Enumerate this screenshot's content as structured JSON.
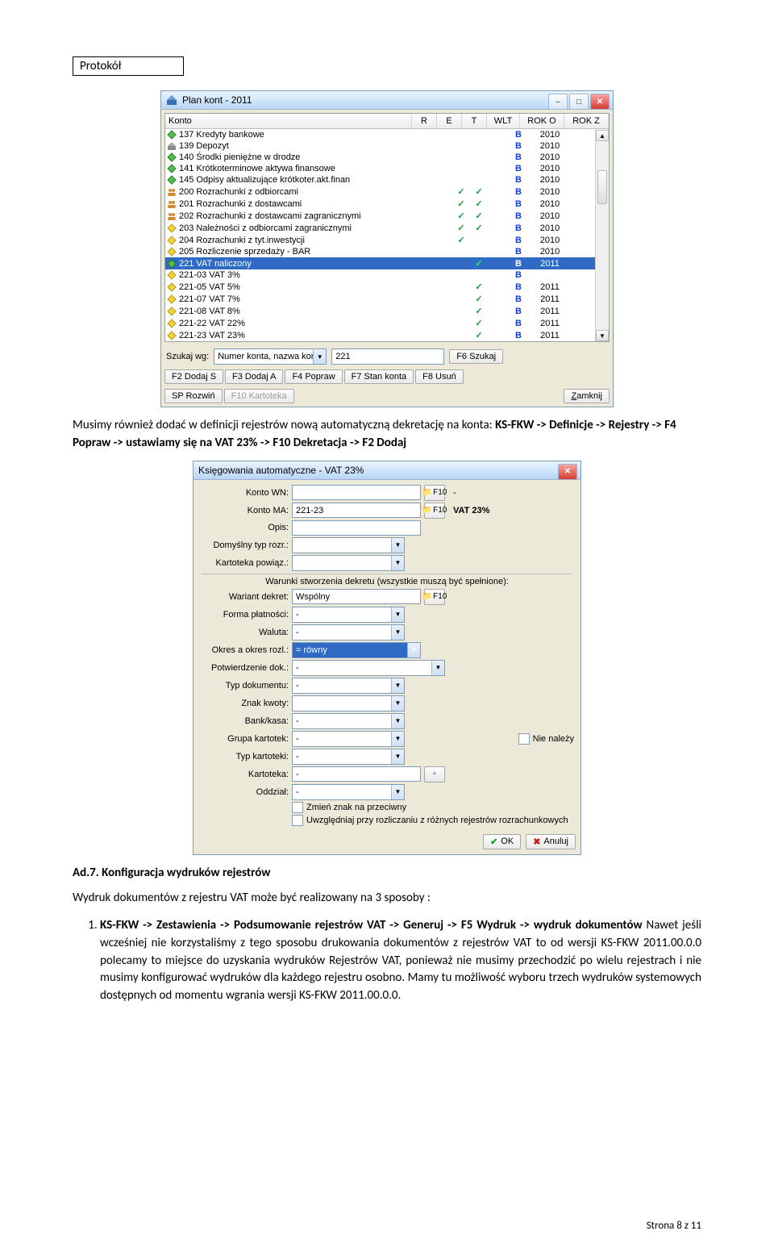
{
  "doc": {
    "header": "Protokół",
    "p1_a": "Musimy również dodać w definicji rejestrów nową automatyczną dekretację na konta: ",
    "p1_b": "KS-FKW -> Definicje -> Rejestry -> F4 Popraw -> ustawiamy się na VAT 23% -> F10 Dekretacja -> F2 Dodaj",
    "ad7": "Ad.7. Konfiguracja wydruków rejestrów",
    "p2": "Wydruk dokumentów z rejestru VAT może być realizowany na 3 sposoby :",
    "li1_b": "KS-FKW -> Zestawienia -> Podsumowanie rejestrów VAT -> Generuj -> F5 Wydruk -> wydruk dokumentów",
    "li1_rest": "Nawet jeśli wcześniej nie korzystaliśmy z tego sposobu drukowania dokumentów z rejestrów VAT to od wersji KS-FKW 2011.00.0.0 polecamy  to miejsce do uzyskania wydruków Rejestrów  VAT, ponieważ nie musimy przechodzić po wielu rejestrach i nie musimy konfigurować wydruków dla każdego rejestru osobno. Mamy tu możliwość wyboru trzech wydruków systemowych dostępnych od momentu wgrania wersji KS-FKW 2011.00.0.0.",
    "footer": "Strona 8 z 11"
  },
  "win1": {
    "title": "Plan kont - 2011",
    "headers": {
      "konto": "Konto",
      "r": "R",
      "e": "E",
      "t": "T",
      "wlt": "WLT",
      "roko": "ROK O",
      "rokz": "ROK Z"
    },
    "rows": [
      {
        "ico": "green",
        "label": "137 Kredyty bankowe",
        "r": "",
        "e": "",
        "t": "",
        "wlt": "B",
        "roko": "2010",
        "rokz": ""
      },
      {
        "ico": "bank",
        "label": "139 Depozyt",
        "r": "",
        "e": "",
        "t": "",
        "wlt": "B",
        "roko": "2010",
        "rokz": ""
      },
      {
        "ico": "green",
        "label": "140  Środki pieniężne w drodze",
        "r": "",
        "e": "",
        "t": "",
        "wlt": "B",
        "roko": "2010",
        "rokz": ""
      },
      {
        "ico": "green",
        "label": "141 Krótkoterminowe aktywa finansowe",
        "r": "",
        "e": "",
        "t": "",
        "wlt": "B",
        "roko": "2010",
        "rokz": ""
      },
      {
        "ico": "green",
        "label": "145 Odpisy aktualizujące krótkoter.akt.finan",
        "r": "",
        "e": "",
        "t": "",
        "wlt": "B",
        "roko": "2010",
        "rokz": ""
      },
      {
        "ico": "people",
        "label": "200 Rozrachunki z odbiorcami",
        "r": "✓",
        "e": "✓",
        "t": "",
        "wlt": "B",
        "roko": "2010",
        "rokz": ""
      },
      {
        "ico": "people",
        "label": "201 Rozrachunki z dostawcami",
        "r": "✓",
        "e": "✓",
        "t": "",
        "wlt": "B",
        "roko": "2010",
        "rokz": ""
      },
      {
        "ico": "people",
        "label": "202 Rozrachunki z dostawcami zagranicznymi",
        "r": "✓",
        "e": "✓",
        "t": "",
        "wlt": "B",
        "roko": "2010",
        "rokz": ""
      },
      {
        "ico": "yellow",
        "label": "203 Należności z odbiorcami zagranicznymi",
        "r": "✓",
        "e": "✓",
        "t": "",
        "wlt": "B",
        "roko": "2010",
        "rokz": ""
      },
      {
        "ico": "yellow",
        "label": "204  Rozrachunki z tyt.inwestycji",
        "r": "✓",
        "e": "",
        "t": "",
        "wlt": "B",
        "roko": "2010",
        "rokz": ""
      },
      {
        "ico": "yellow",
        "label": "205 Rozliczenie sprzedaży - BAR",
        "r": "",
        "e": "",
        "t": "",
        "wlt": "B",
        "roko": "2010",
        "rokz": ""
      },
      {
        "ico": "green",
        "label": "221 VAT naliczony",
        "r": "",
        "e": "✓",
        "t": "",
        "wlt": "B",
        "roko": "2011",
        "rokz": "",
        "sel": true
      },
      {
        "ico": "yellow",
        "label": "221-03 VAT 3%",
        "r": "",
        "e": "",
        "t": "",
        "wlt": "B",
        "roko": "",
        "rokz": ""
      },
      {
        "ico": "yellow",
        "label": "221-05 VAT 5%",
        "r": "",
        "e": "✓",
        "t": "",
        "wlt": "B",
        "roko": "2011",
        "rokz": ""
      },
      {
        "ico": "yellow",
        "label": "221-07 VAT 7%",
        "r": "",
        "e": "✓",
        "t": "",
        "wlt": "B",
        "roko": "2011",
        "rokz": ""
      },
      {
        "ico": "yellow",
        "label": "221-08 VAT 8%",
        "r": "",
        "e": "✓",
        "t": "",
        "wlt": "B",
        "roko": "2011",
        "rokz": ""
      },
      {
        "ico": "yellow",
        "label": "221-22 VAT 22%",
        "r": "",
        "e": "✓",
        "t": "",
        "wlt": "B",
        "roko": "2011",
        "rokz": ""
      },
      {
        "ico": "yellow",
        "label": "221-23 VAT 23%",
        "r": "",
        "e": "✓",
        "t": "",
        "wlt": "B",
        "roko": "2011",
        "rokz": ""
      }
    ],
    "search": {
      "label": "Szukaj wg:",
      "combo": "Numer konta, nazwa kor",
      "val": "221",
      "btn": "F6 Szukaj"
    },
    "toolbar": {
      "b1": "F2 Dodaj S",
      "b2": "F3 Dodaj A",
      "b3": "F4 Popraw",
      "b4": "F7 Stan konta",
      "b5": "F8 Usuń",
      "b6": "SP Rozwiń",
      "b7": "F10 Kartoteka",
      "close": "Zamknij"
    }
  },
  "win2": {
    "title": "Księgowania automatyczne - VAT 23%",
    "f": {
      "konto_wn_lbl": "Konto WN:",
      "konto_wn": "",
      "konto_wn_side": "-",
      "konto_ma_lbl": "Konto MA:",
      "konto_ma": "221-23",
      "konto_ma_side": "VAT 23%",
      "opis_lbl": "Opis:",
      "domrozr_lbl": "Domyślny typ rozr.:",
      "karpow_lbl": "Kartoteka powiąz.:",
      "hint": "Warunki stworzenia dekretu (wszystkie muszą być spełnione):",
      "wariant_lbl": "Wariant dekret:",
      "wariant": "Wspólny",
      "forma_lbl": "Forma płatności:",
      "forma": "-",
      "waluta_lbl": "Waluta:",
      "waluta": "-",
      "okres_lbl": "Okres a okres rozl.:",
      "okres": "=   równy",
      "potw_lbl": "Potwierdzenie dok.:",
      "potw": "-",
      "typdok_lbl": "Typ dokumentu:",
      "typdok": "-",
      "znak_lbl": "Znak kwoty:",
      "bank_lbl": "Bank/kasa:",
      "bank": "-",
      "grupa_lbl": "Grupa kartotek:",
      "grupa": "-",
      "nie_nalezy": "Nie należy",
      "typkar_lbl": "Typ kartoteki:",
      "typkar": "-",
      "kart_lbl": "Kartoteka:",
      "kart": "-",
      "oddzial_lbl": "Oddział:",
      "oddzial": "-",
      "chk1": "Zmień znak na przeciwny",
      "chk2": "Uwzględniaj przy rozliczaniu z różnych rejestrów rozrachunkowych",
      "fkey": "F10"
    },
    "ok": "OK",
    "anuluj": "Anuluj"
  }
}
